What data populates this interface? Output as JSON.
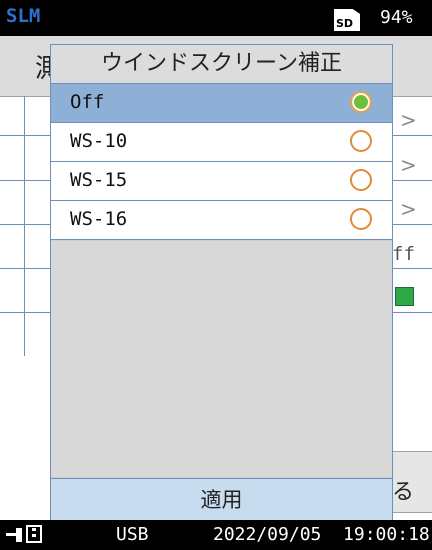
{
  "status": {
    "app_name": "SLM",
    "storage_icon_label": "SD",
    "battery": "94%"
  },
  "background_screen": {
    "header_partial": "測",
    "chevron": ">",
    "partial_value": "ff",
    "partial_button": "る",
    "indicator_color": "#2fa84a"
  },
  "dialog": {
    "title": "ウインドスクリーン補正",
    "options": [
      {
        "label": "Off",
        "selected": true
      },
      {
        "label": "WS-10",
        "selected": false
      },
      {
        "label": "WS-15",
        "selected": false
      },
      {
        "label": "WS-16",
        "selected": false
      }
    ],
    "apply_label": "適用"
  },
  "bottom": {
    "connection": "USB",
    "datetime": "2022/09/05  19:00:18"
  },
  "colors": {
    "app_name": "#2f6fd0",
    "selected_row": "#8fb0d6",
    "radio_on": "#6fbf3a",
    "radio_ring": "#e08b3a",
    "apply_bg": "#c8dcf0"
  }
}
